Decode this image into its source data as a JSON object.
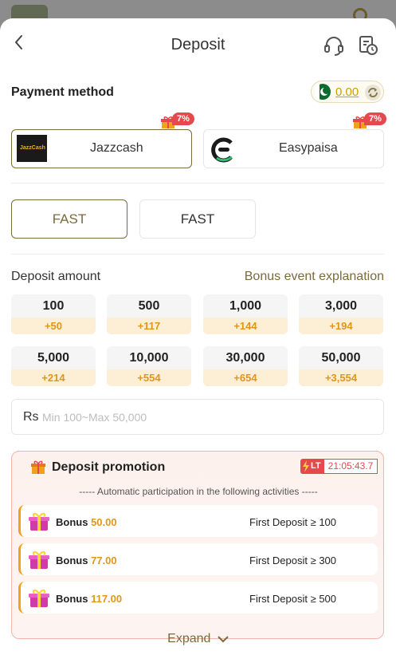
{
  "header": {
    "title": "Deposit"
  },
  "payment": {
    "title": "Payment method",
    "balance": "0.00",
    "methods": [
      {
        "label": "Jazzcash",
        "logo_text": "JazzCash",
        "badge": "7%"
      },
      {
        "label": "Easypaisa",
        "badge": "7%"
      }
    ]
  },
  "channels": [
    "FAST",
    "FAST"
  ],
  "amount": {
    "title": "Deposit amount",
    "link": "Bonus event explanation",
    "options": [
      {
        "value": "100",
        "bonus": "+50"
      },
      {
        "value": "500",
        "bonus": "+117"
      },
      {
        "value": "1,000",
        "bonus": "+144"
      },
      {
        "value": "3,000",
        "bonus": "+194"
      },
      {
        "value": "5,000",
        "bonus": "+214"
      },
      {
        "value": "10,000",
        "bonus": "+554"
      },
      {
        "value": "30,000",
        "bonus": "+654"
      },
      {
        "value": "50,000",
        "bonus": "+3,554"
      }
    ],
    "currency": "Rs",
    "placeholder": "Min 100~Max 50,000"
  },
  "promotion": {
    "title": "Deposit promotion",
    "badge": "LT",
    "timer": "21:05:43.7",
    "subtitle": "----- Automatic participation in the following activities -----",
    "bonus_label": "Bonus",
    "rows": [
      {
        "amount": "50.00",
        "condition": "First Deposit ≥ 100"
      },
      {
        "amount": "77.00",
        "condition": "First Deposit ≥ 300"
      },
      {
        "amount": "117.00",
        "condition": "First Deposit ≥ 500"
      }
    ]
  },
  "expand_label": "Expand",
  "colors": {
    "accent": "#7a6a3c",
    "bonus": "#e0961a",
    "badge": "#e5484d",
    "balance": "#c9a100"
  }
}
